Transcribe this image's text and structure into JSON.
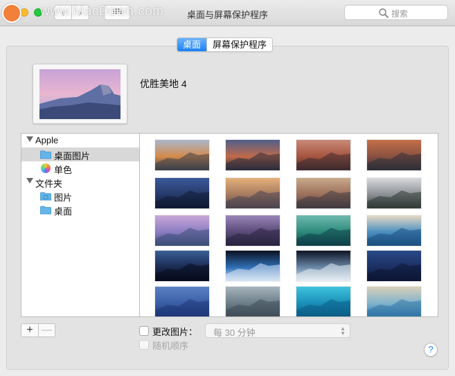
{
  "window": {
    "title": "桌面与屏幕保护程序",
    "watermark": "www.MacDown.com",
    "search_placeholder": "搜索",
    "grid_glyph": "⠿⠿"
  },
  "tabs": [
    {
      "label": "桌面",
      "active": true
    },
    {
      "label": "屏幕保护程序",
      "active": false
    }
  ],
  "current": {
    "name": "优胜美地 4"
  },
  "sidebar": {
    "groups": [
      {
        "label": "Apple",
        "items": [
          {
            "label": "桌面图片",
            "icon": "folder-icon",
            "selected": true
          },
          {
            "label": "单色",
            "icon": "color-wheel-icon",
            "selected": false
          }
        ]
      },
      {
        "label": "文件夹",
        "items": [
          {
            "label": "图片",
            "icon": "folder-icon",
            "selected": false
          },
          {
            "label": "桌面",
            "icon": "folder-icon",
            "selected": false
          }
        ]
      }
    ]
  },
  "thumbnails": [
    {
      "name": "el-capitan-sunset",
      "colors": [
        "#a9b7cc",
        "#d58a4a",
        "#3a3f4a"
      ]
    },
    {
      "name": "sierra-peaks",
      "colors": [
        "#4f5f8a",
        "#c06a4a",
        "#2a2c3d"
      ]
    },
    {
      "name": "sierra-dusk",
      "colors": [
        "#c98a78",
        "#a5543f",
        "#3e2b2f"
      ]
    },
    {
      "name": "el-capitan-dawn",
      "colors": [
        "#c4704a",
        "#8a5040",
        "#2d2f38"
      ]
    },
    {
      "name": "yosemite-night",
      "colors": [
        "#3a5a9a",
        "#253a6a",
        "#111a33"
      ]
    },
    {
      "name": "half-dome-gold",
      "colors": [
        "#e4b07a",
        "#a77a60",
        "#4a4450"
      ]
    },
    {
      "name": "el-capitan-rock",
      "colors": [
        "#c9a98a",
        "#9a6f5a",
        "#3f3a40"
      ]
    },
    {
      "name": "yosemite-valley-fog",
      "colors": [
        "#d8dadc",
        "#8b8f95",
        "#2f3a35"
      ]
    },
    {
      "name": "yosemite-4",
      "colors": [
        "#c8a8d8",
        "#8a7cc2",
        "#3c4f78"
      ]
    },
    {
      "name": "yosemite-lake",
      "colors": [
        "#9a86b8",
        "#5a4a78",
        "#2a2440"
      ]
    },
    {
      "name": "mavericks-wave",
      "colors": [
        "#6fb9b0",
        "#2c8a7a",
        "#0f3f4a"
      ]
    },
    {
      "name": "ocean-wave",
      "colors": [
        "#e8d9c4",
        "#4a8fc0",
        "#1c4f82"
      ]
    },
    {
      "name": "galaxy",
      "colors": [
        "#3a5f95",
        "#1a2a50",
        "#070b1c"
      ]
    },
    {
      "name": "earth-horizon",
      "colors": [
        "#0b1020",
        "#2f6fb5",
        "#d8e6f5"
      ]
    },
    {
      "name": "earth-clouds",
      "colors": [
        "#0d1424",
        "#6a87a8",
        "#e4ecf2"
      ]
    },
    {
      "name": "milky-way",
      "colors": [
        "#284a88",
        "#1b2f62",
        "#0c1633"
      ]
    },
    {
      "name": "blue-sky-moon",
      "colors": [
        "#5b82c4",
        "#3a5ea6",
        "#1e3676"
      ]
    },
    {
      "name": "storm-clouds",
      "colors": [
        "#a7b4bd",
        "#6b7d88",
        "#3f4d57"
      ]
    },
    {
      "name": "turquoise-water",
      "colors": [
        "#3ec3dc",
        "#1a8fb8",
        "#0b5c86"
      ]
    },
    {
      "name": "beach-shore",
      "colors": [
        "#d8cfb8",
        "#7fb3cc",
        "#2f74a6"
      ]
    }
  ],
  "controls": {
    "add_label": "+",
    "remove_label": "—",
    "change_picture_label": "更改图片：",
    "interval_value": "每 30 分钟",
    "random_order_label": "随机顺序",
    "help_label": "?"
  }
}
